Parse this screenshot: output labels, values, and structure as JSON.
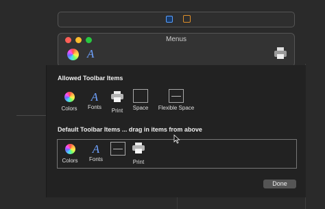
{
  "menus_window": {
    "title": "Menus"
  },
  "allowed": {
    "heading": "Allowed Toolbar Items",
    "items": [
      {
        "label": "Colors",
        "icon": "color-wheel-icon"
      },
      {
        "label": "Fonts",
        "icon": "font-icon"
      },
      {
        "label": "Print",
        "icon": "printer-icon"
      },
      {
        "label": "Space",
        "icon": "space-icon"
      },
      {
        "label": "Flexible Space",
        "icon": "flexible-space-icon"
      }
    ]
  },
  "default": {
    "heading": "Default Toolbar Items ... drag in items from above",
    "items": [
      {
        "label": "Colors",
        "icon": "color-wheel-icon"
      },
      {
        "label": "Fonts",
        "icon": "font-icon"
      },
      {
        "label": "",
        "icon": "flexible-space-icon"
      },
      {
        "label": "Print",
        "icon": "printer-icon"
      }
    ]
  },
  "done_label": "Done",
  "colors": {
    "accent_font": "#6fa2ff",
    "close": "#ff5f57",
    "minimize": "#febc2e",
    "maximize": "#28c840"
  }
}
